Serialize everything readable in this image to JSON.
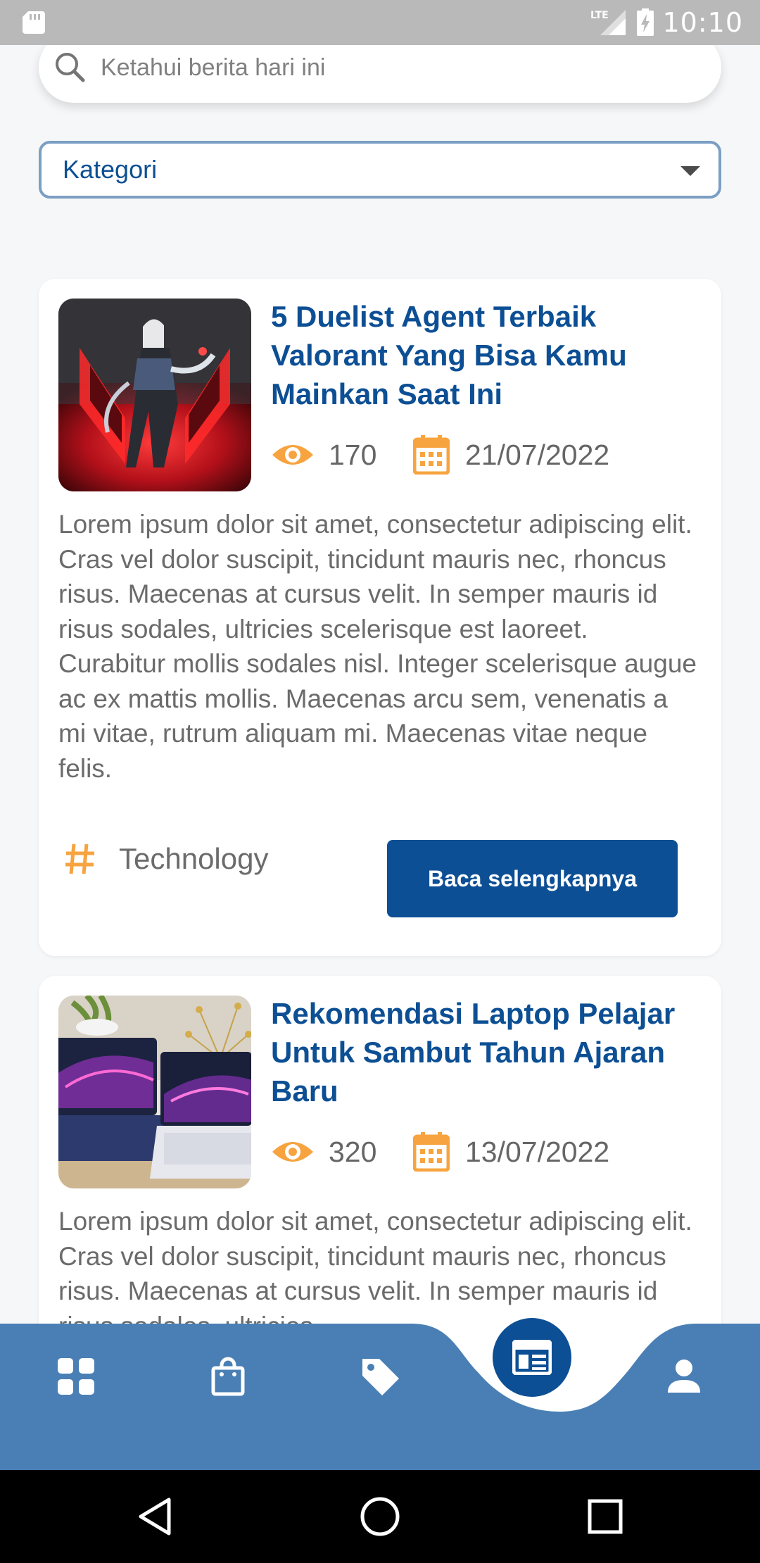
{
  "status_bar": {
    "network": "LTE",
    "time": "10:10",
    "icons": [
      "sd-card-icon",
      "signal-icon",
      "battery-icon"
    ]
  },
  "search": {
    "placeholder": "Ketahui berita hari ini",
    "icon": "search-icon"
  },
  "category_filter": {
    "label": "Kategori",
    "icon": "caret-down-icon"
  },
  "articles": [
    {
      "title": "5 Duelist Agent Terbaik Valorant Yang Bisa Kamu Mainkan Saat Ini",
      "views": "170",
      "date": "21/07/2022",
      "excerpt": "Lorem ipsum dolor sit amet, consectetur adipiscing elit. Cras vel dolor suscipit, tincidunt mauris nec, rhoncus risus. Maecenas at cursus velit. In semper mauris id risus sodales, ultricies scelerisque est laoreet. Curabitur mollis sodales nisl. Integer scelerisque augue ac ex mattis mollis. Maecenas arcu sem, venenatis a mi vitae, rutrum aliquam mi. Maecenas vitae neque felis.",
      "category": "Technology",
      "cta": "Baca selengkapnya"
    },
    {
      "title": "Rekomendasi Laptop Pelajar Untuk Sambut Tahun Ajaran Baru",
      "views": "320",
      "date": "13/07/2022",
      "excerpt": "Lorem ipsum dolor sit amet, consectetur adipiscing elit. Cras vel dolor suscipit, tincidunt mauris nec, rhoncus risus. Maecenas at cursus velit. In semper mauris id risus sodales, ultricies"
    }
  ],
  "bottom_nav": {
    "items": [
      "dashboard-icon",
      "shopping-bag-icon",
      "tag-icon",
      "newspaper-icon",
      "person-icon"
    ],
    "active": "newspaper-icon",
    "bar_color": "#4a7fb5",
    "accent": "#0d4f94"
  },
  "system_nav": [
    "back-icon",
    "home-icon",
    "recents-icon"
  ],
  "colors": {
    "primary": "#0d4f94",
    "icon_accent": "#f7a440",
    "text_muted": "#6b6b6b",
    "background": "#f6f7f8"
  }
}
